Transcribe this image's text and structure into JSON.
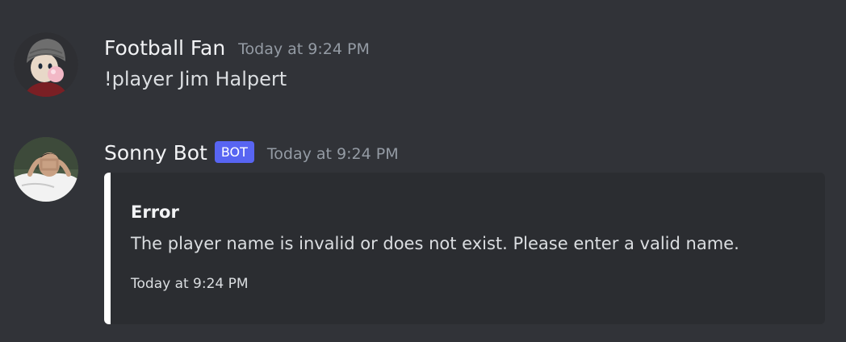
{
  "messages": [
    {
      "author": "Football Fan",
      "timestamp": "Today at 9:24 PM",
      "content": "!player Jim Halpert"
    },
    {
      "author": "Sonny Bot",
      "bot_tag": "BOT",
      "timestamp": "Today at 9:24 PM",
      "embed": {
        "title": "Error",
        "description": "The player name is invalid or does not exist. Please enter a valid name.",
        "footer": "Today at 9:24 PM",
        "accent_color": "#ffffff"
      }
    }
  ],
  "colors": {
    "background": "#313338",
    "embed_background": "#2b2d31",
    "bot_tag": "#5865f2",
    "timestamp": "#949ba4"
  }
}
